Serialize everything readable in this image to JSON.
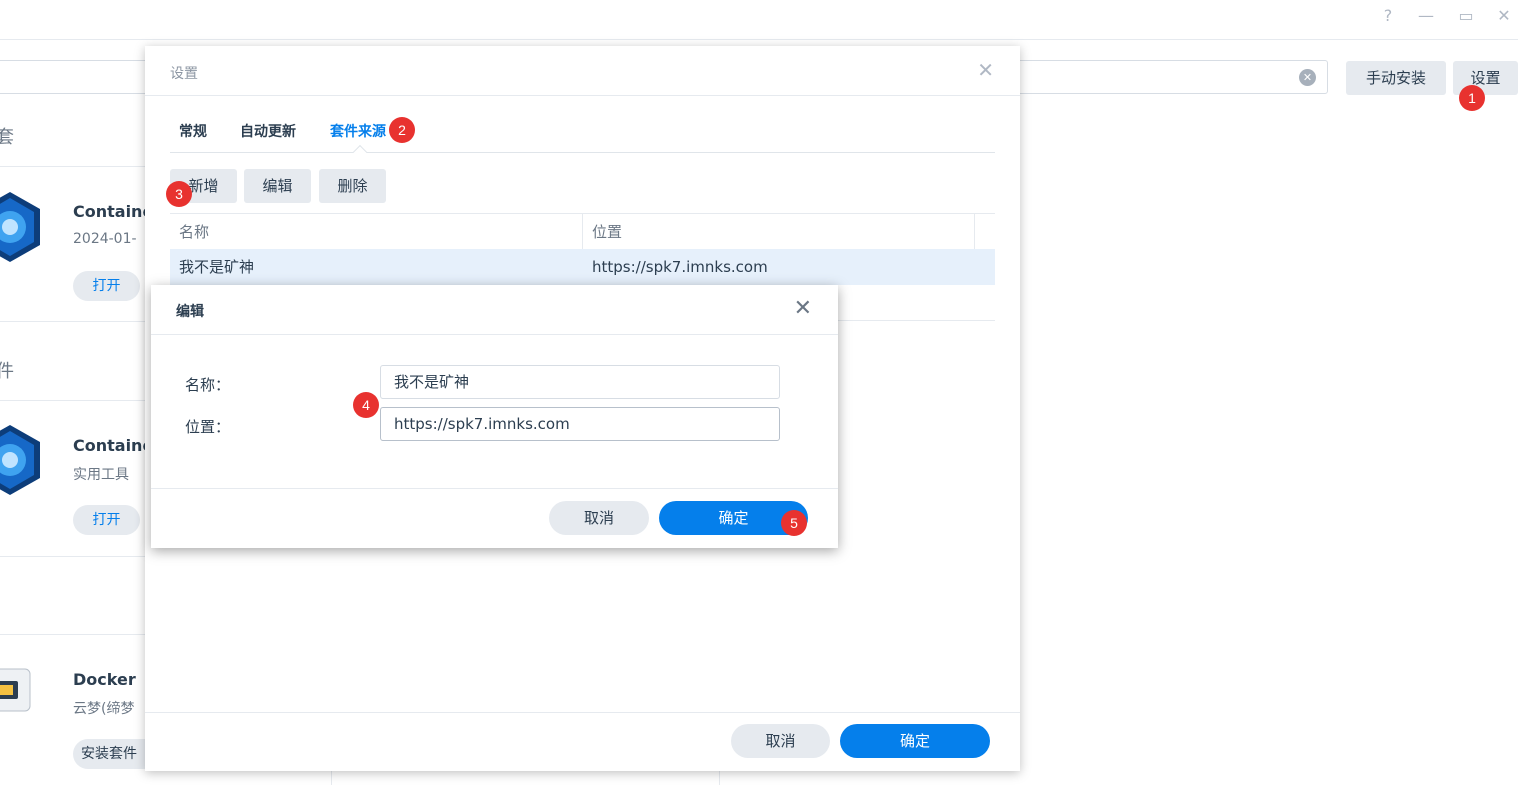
{
  "window": {
    "controls": {
      "help": "?",
      "minimize": "—",
      "restore": "▭",
      "close": "✕"
    }
  },
  "background": {
    "search_clear": "✕",
    "manual_install_label": "手动安装",
    "settings_label": "设置",
    "side_labels": [
      "套",
      "件"
    ],
    "packages": [
      {
        "title": "Container Manager",
        "subtitle": "2024-01-",
        "button": "打开"
      },
      {
        "title": "Container",
        "subtitle": "实用工具",
        "button": "打开"
      },
      {
        "title": "Docker",
        "subtitle": "云梦(缔梦",
        "button": "安装套件"
      }
    ]
  },
  "settings_dialog": {
    "title": "设置",
    "close": "✕",
    "tabs": [
      {
        "label": "常规"
      },
      {
        "label": "自动更新"
      },
      {
        "label": "套件来源"
      }
    ],
    "toolbar": {
      "add": "新增",
      "edit": "编辑",
      "delete": "删除"
    },
    "columns": [
      "名称",
      "位置"
    ],
    "rows": [
      {
        "name": "我不是矿神",
        "location": "https://spk7.imnks.com"
      }
    ],
    "footer": {
      "cancel": "取消",
      "ok": "确定"
    }
  },
  "edit_dialog": {
    "title": "编辑",
    "close": "✕",
    "name_label": "名称：",
    "name_value": "我不是矿神",
    "location_label": "位置：",
    "location_value": "https://spk7.imnks.com",
    "cancel": "取消",
    "ok": "确定"
  },
  "markers": [
    "1",
    "2",
    "3",
    "4",
    "5"
  ],
  "colors": {
    "accent": "#057feb",
    "marker": "#e8322f",
    "button_bg": "#e6eaef"
  }
}
